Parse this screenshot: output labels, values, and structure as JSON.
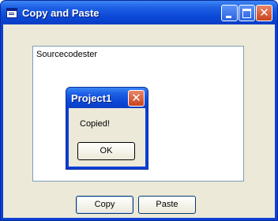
{
  "window": {
    "title": "Copy and Paste",
    "text_content": "Sourcecodester"
  },
  "buttons": {
    "copy": "Copy",
    "paste": "Paste"
  },
  "dialog": {
    "title": "Project1",
    "message": "Copied!",
    "ok": "OK"
  },
  "icons": [
    "app-icon",
    "minimize-icon",
    "maximize-icon",
    "close-icon"
  ]
}
